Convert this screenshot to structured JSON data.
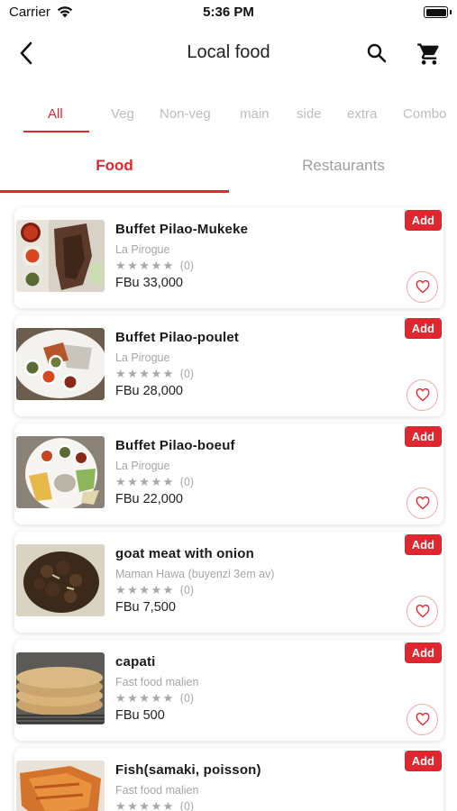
{
  "status_bar": {
    "carrier": "Carrier",
    "time": "5:36 PM"
  },
  "header": {
    "title": "Local food",
    "back_icon": "chevron-left-icon",
    "search_icon": "search-icon",
    "cart_icon": "cart-icon"
  },
  "categories": [
    {
      "label": "All",
      "active": true
    },
    {
      "label": "Veg",
      "active": false
    },
    {
      "label": "Non-veg",
      "active": false
    },
    {
      "label": "main",
      "active": false
    },
    {
      "label": "side",
      "active": false
    },
    {
      "label": "extra",
      "active": false
    },
    {
      "label": "Combo",
      "active": false
    }
  ],
  "main_tabs": [
    {
      "label": "Food",
      "active": true
    },
    {
      "label": "Restaurants",
      "active": false
    }
  ],
  "colors": {
    "accent": "#e0262f",
    "muted": "#a6a6a6"
  },
  "add_label": "Add",
  "items": [
    {
      "name": "Buffet Pilao-Mukeke",
      "restaurant": "La Pirogue",
      "stars": "★★★★★",
      "reviews": "(0)",
      "price": "FBu 33,000"
    },
    {
      "name": "Buffet Pilao-poulet",
      "restaurant": "La Pirogue",
      "stars": "★★★★★",
      "reviews": "(0)",
      "price": "FBu 28,000"
    },
    {
      "name": "Buffet Pilao-boeuf",
      "restaurant": "La Pirogue",
      "stars": "★★★★★",
      "reviews": "(0)",
      "price": "FBu 22,000"
    },
    {
      "name": "goat meat with onion",
      "restaurant": "Maman Hawa (buyenzi 3em av)",
      "stars": "★★★★★",
      "reviews": "(0)",
      "price": "FBu 7,500"
    },
    {
      "name": "capati",
      "restaurant": "Fast food malien",
      "stars": "★★★★★",
      "reviews": "(0)",
      "price": "FBu 500"
    },
    {
      "name": "Fish(samaki, poisson)",
      "restaurant": "Fast food malien",
      "stars": "★★★★★",
      "reviews": "(0)",
      "price": ""
    }
  ]
}
